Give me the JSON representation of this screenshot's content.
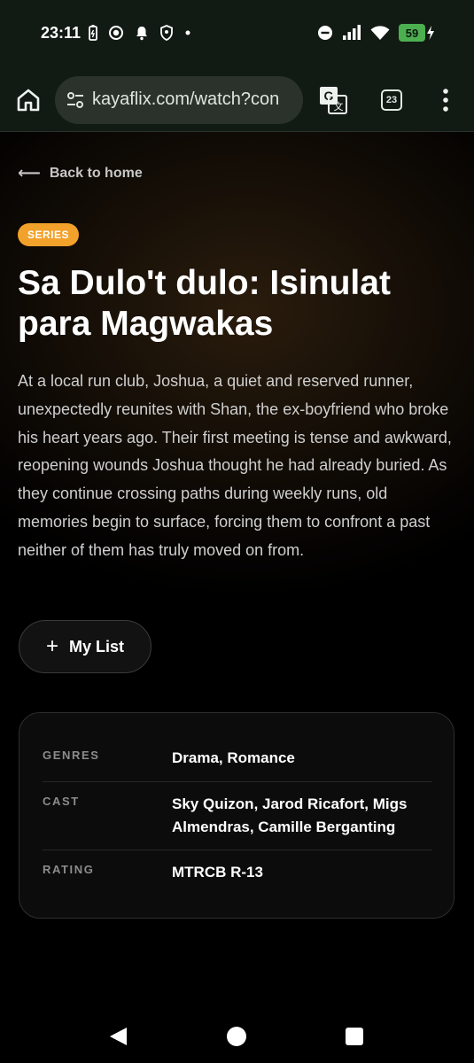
{
  "status_bar": {
    "time": "23:11",
    "battery": "59"
  },
  "browser": {
    "url": "kayaflix.com/watch?con",
    "tab_count": "23"
  },
  "page": {
    "back_label": "Back to home",
    "badge": "SERIES",
    "title": "Sa Dulo't dulo: Isinulat para Magwakas",
    "description": "At a local run club, Joshua, a quiet and reserved runner, unexpectedly reunites with Shan, the ex-boyfriend who broke his heart years ago. Their first meeting is tense and awkward, reopening wounds Joshua thought he had already buried. As they continue crossing paths during weekly runs, old memories begin to surface, forcing them to confront a past neither of them has truly moved on from.",
    "my_list_label": "My List",
    "info": [
      {
        "label": "GENRES",
        "value": "Drama, Romance"
      },
      {
        "label": "CAST",
        "value": "Sky Quizon, Jarod Ricafort, Migs Almendras, Camille Berganting"
      },
      {
        "label": "RATING",
        "value": "MTRCB R-13"
      }
    ]
  },
  "colors": {
    "badge": "#f2a12b",
    "battery": "#4caf50",
    "browser_bar": "#121a14"
  },
  "icons": [
    "home-icon",
    "tune-icon",
    "translate-icon",
    "tabs-icon",
    "more-vert-icon",
    "arrow-left-icon",
    "plus-icon",
    "nav-back-icon",
    "nav-home-icon",
    "nav-recents-icon"
  ]
}
